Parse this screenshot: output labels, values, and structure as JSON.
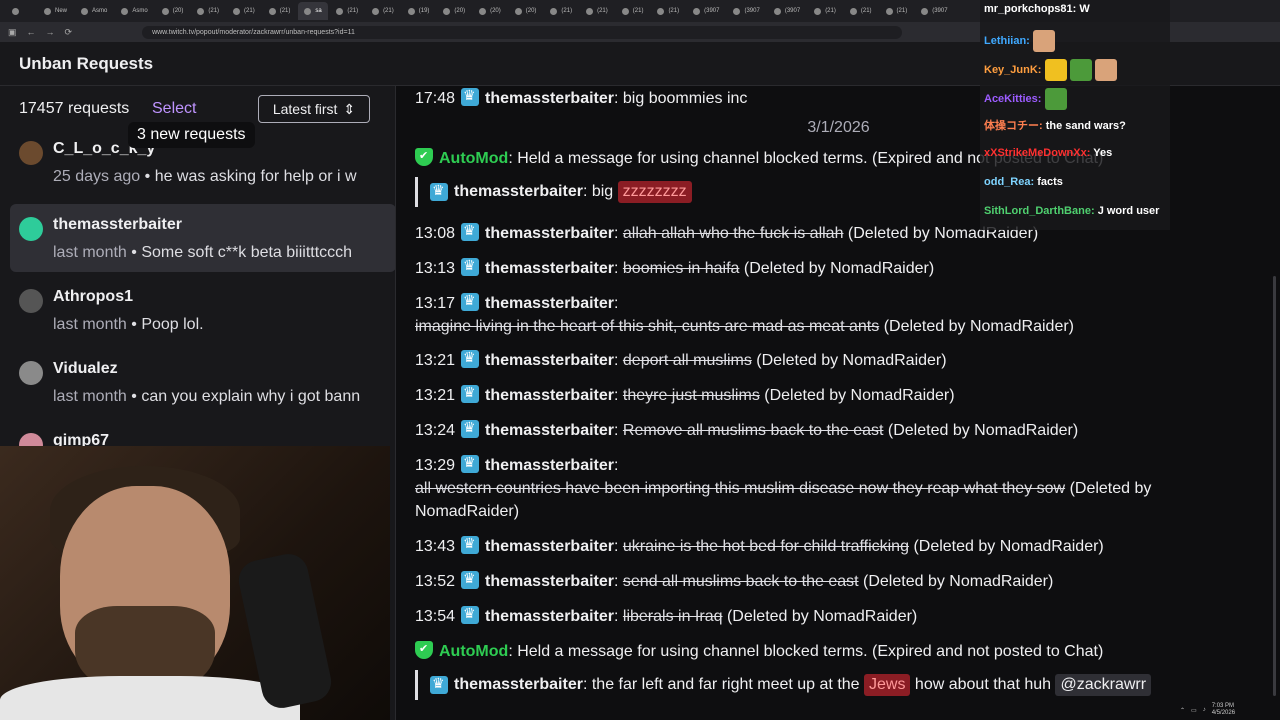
{
  "browser": {
    "tabs": [
      {
        "label": ""
      },
      {
        "label": "New"
      },
      {
        "label": "Asmo"
      },
      {
        "label": "Asmo"
      },
      {
        "label": "(20)"
      },
      {
        "label": "(21)"
      },
      {
        "label": "(21)"
      },
      {
        "label": "(21)"
      },
      {
        "label": "sa",
        "active": true
      },
      {
        "label": "(21)"
      },
      {
        "label": "(21)"
      },
      {
        "label": "(19)"
      },
      {
        "label": "(20)"
      },
      {
        "label": "(20)"
      },
      {
        "label": "(20)"
      },
      {
        "label": "(21)"
      },
      {
        "label": "(21)"
      },
      {
        "label": "(21)"
      },
      {
        "label": "(21)"
      },
      {
        "label": "(3907"
      },
      {
        "label": "(3907"
      },
      {
        "label": "(3907"
      },
      {
        "label": "(21)"
      },
      {
        "label": "(21)"
      },
      {
        "label": "(21)"
      },
      {
        "label": "(3907"
      }
    ],
    "url": "www.twitch.tv/popout/moderator/zackrawrr/unban-requests?id=11"
  },
  "header": {
    "title": "Unban Requests"
  },
  "list": {
    "count_label": "17457 requests",
    "select_label": "Select",
    "sort_label": "Latest first",
    "new_requests_label": "3 new requests",
    "items": [
      {
        "name": "C_L_o_c_k_y",
        "age": "25 days ago",
        "preview": "he was asking for help or i w",
        "avatar_color": "#6b4a2e"
      },
      {
        "name": "themassterbaiter",
        "age": "last month",
        "preview": "Some soft c**k beta biiitttccch",
        "avatar_color": "#2ecc9a"
      },
      {
        "name": "Athropos1",
        "age": "last month",
        "preview": "Poop lol.",
        "avatar_color": "#555"
      },
      {
        "name": "Vidualez",
        "age": "last month",
        "preview": "can you explain why i got bann",
        "avatar_color": "#8a8a8a"
      },
      {
        "name": "gimp67",
        "age": "",
        "preview": "",
        "avatar_color": "#d08a9a"
      }
    ]
  },
  "log": {
    "top_line": {
      "time": "17:48",
      "user": "themassterbaiter",
      "text": "big boommies inc"
    },
    "date_sep": "3/1/2026",
    "automod_1": {
      "name": "AutoMod",
      "text": "Held a message for using channel blocked terms. (Expired and not posted to Chat)"
    },
    "held_1": {
      "user": "themassterbaiter",
      "text_pre": "big",
      "flag": "zzzzzzzz"
    },
    "messages": [
      {
        "time": "13:08",
        "user": "themassterbaiter",
        "text": "allah allah who the fuck is allah",
        "note": "(Deleted by NomadRaider)"
      },
      {
        "time": "13:13",
        "user": "themassterbaiter",
        "text": "boomies in haifa",
        "note": "(Deleted by NomadRaider)"
      },
      {
        "time": "13:17",
        "user": "themassterbaiter",
        "text": "imagine living in the heart of this shit, cunts are mad as meat ants",
        "note": "(Deleted by NomadRaider)"
      },
      {
        "time": "13:21",
        "user": "themassterbaiter",
        "text": "deport all muslims",
        "note": "(Deleted by NomadRaider)"
      },
      {
        "time": "13:21",
        "user": "themassterbaiter",
        "text": "theyre just muslims",
        "note": "(Deleted by NomadRaider)"
      },
      {
        "time": "13:24",
        "user": "themassterbaiter",
        "text": "Remove all muslims back to the east",
        "note": "(Deleted by NomadRaider)"
      },
      {
        "time": "13:29",
        "user": "themassterbaiter",
        "text": "all western countries have been importing this muslim disease now they reap what they sow",
        "note": "(Deleted by",
        "note2": "NomadRaider)"
      },
      {
        "time": "13:43",
        "user": "themassterbaiter",
        "text": "ukraine is the hot bed for child trafficking",
        "note": "(Deleted by NomadRaider)"
      },
      {
        "time": "13:52",
        "user": "themassterbaiter",
        "text": "send all muslims back to the east",
        "note": "(Deleted by NomadRaider)"
      },
      {
        "time": "13:54",
        "user": "themassterbaiter",
        "text": "liberals in Iraq",
        "note": "(Deleted by NomadRaider)"
      }
    ],
    "automod_2": {
      "name": "AutoMod",
      "text": "Held a message for using channel blocked terms. (Expired and not posted to Chat)"
    },
    "held_2": {
      "user": "themassterbaiter",
      "text_pre": "the far left and far right meet up at the",
      "flag": "Jews",
      "text_post": "how about that huh",
      "mention": "@zackrawrr"
    }
  },
  "overlay_chat": [
    {
      "user": "mr_porkchops81:",
      "text": "W",
      "color": "#ffffff"
    },
    {
      "user": "Lethiian:",
      "text": "",
      "color": "#3fa9ff"
    },
    {
      "user": "Key_JunK:",
      "text": "",
      "color": "#ff9e3f"
    },
    {
      "user": "AceKitties:",
      "text": "",
      "color": "#9c5cff"
    },
    {
      "user": "体操コチー:",
      "text": "the sand wars?",
      "color": "#ff7f50"
    },
    {
      "user": "xXStrikeMeDownXx:",
      "text": "Yes",
      "color": "#ff3030"
    },
    {
      "user": "odd_Rea:",
      "text": "facts",
      "color": "#7fd4ff"
    },
    {
      "user": "SithLord_DarthBane:",
      "text": "J word user",
      "color": "#4fd06f"
    }
  ],
  "tray": {
    "time": "7:03 PM",
    "date": "4/5/2026"
  },
  "colors": {
    "accent": "#bf94ff",
    "automod": "#2ecc52",
    "badge": "#3fa9d6",
    "flag": "#8b1d24"
  }
}
